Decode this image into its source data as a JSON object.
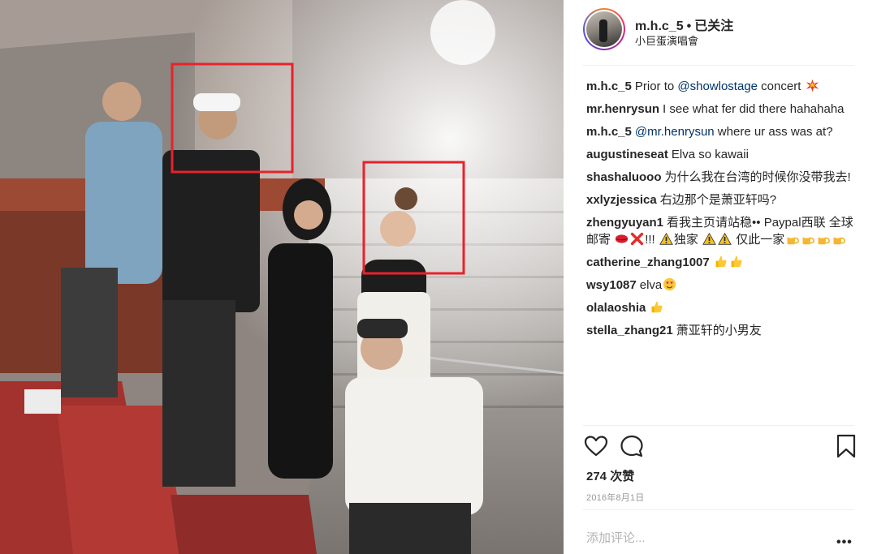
{
  "post": {
    "username": "m.h.c_5",
    "separator": "•",
    "follow_status": "已关注",
    "location": "小巨蛋演唱會"
  },
  "comments": [
    {
      "user": "m.h.c_5",
      "text_before": "Prior to ",
      "mention": "@showlostage",
      "text_after": " concert",
      "emoji": [
        "collision-emoji"
      ]
    },
    {
      "user": "mr.henrysun",
      "text": "I see what fer did there hahahaha"
    },
    {
      "user": "m.h.c_5",
      "mention": "@mr.henrysun",
      "text_after": " where ur ass was at?"
    },
    {
      "user": "augustineseat",
      "text": "Elva so kawaii"
    },
    {
      "user": "shashaluooo",
      "text": "为什么我在台湾的时候你没带我去!"
    },
    {
      "user": "xxlyzjessica",
      "text": "右边那个是萧亚轩吗?"
    },
    {
      "user": "zhengyuyan1",
      "part1": "看我主页请站稳•• Paypal西联 全球邮寄",
      "part2": "!!!",
      "part3": "独家",
      "part4": "仅此一家"
    },
    {
      "user": "catherine_zhang1007",
      "text": ""
    },
    {
      "user": "wsy1087",
      "text": "elva"
    },
    {
      "user": "olalaoshia",
      "text": ""
    },
    {
      "user": "stella_zhang21",
      "text": "萧亚轩的小男友"
    }
  ],
  "actions": {
    "like_icon": "heart-icon",
    "comment_icon": "comment-bubble-icon",
    "save_icon": "bookmark-icon",
    "likes_text": "274 次赞",
    "date": "2016年8月1日"
  },
  "add_comment": {
    "placeholder": "添加评论...",
    "more": "•••"
  },
  "colors": {
    "mention": "#003569",
    "highlight_box": "#e8222b",
    "divider": "#efefef"
  }
}
